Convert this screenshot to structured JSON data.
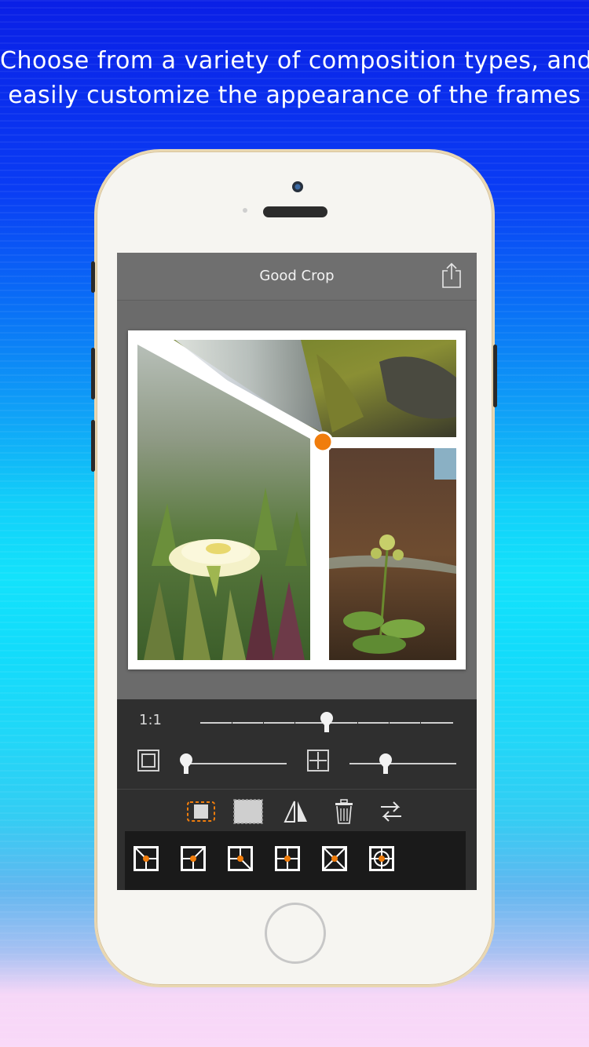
{
  "promo": {
    "line1": "Choose from a variety of composition types, and",
    "line2": "easily customize the appearance of the frames"
  },
  "app": {
    "title": "Good Crop",
    "share_icon": "share-icon"
  },
  "controls": {
    "aspect_ratio_label": "1:1",
    "aspect_slider_value": 0.5,
    "border_slider_value": 0.0,
    "spacing_slider_value": 0.35
  },
  "toolbar": {
    "icons": [
      "frame-select-icon",
      "background-frame-icon",
      "flip-icon",
      "trash-icon",
      "swap-icon"
    ]
  },
  "compositions": {
    "items": [
      "composition-1",
      "composition-2",
      "composition-3",
      "composition-4",
      "composition-5",
      "composition-6"
    ]
  },
  "colors": {
    "accent": "#f07d0c",
    "dark_panel": "#2f2f2f",
    "tray": "#1a1a1a"
  }
}
